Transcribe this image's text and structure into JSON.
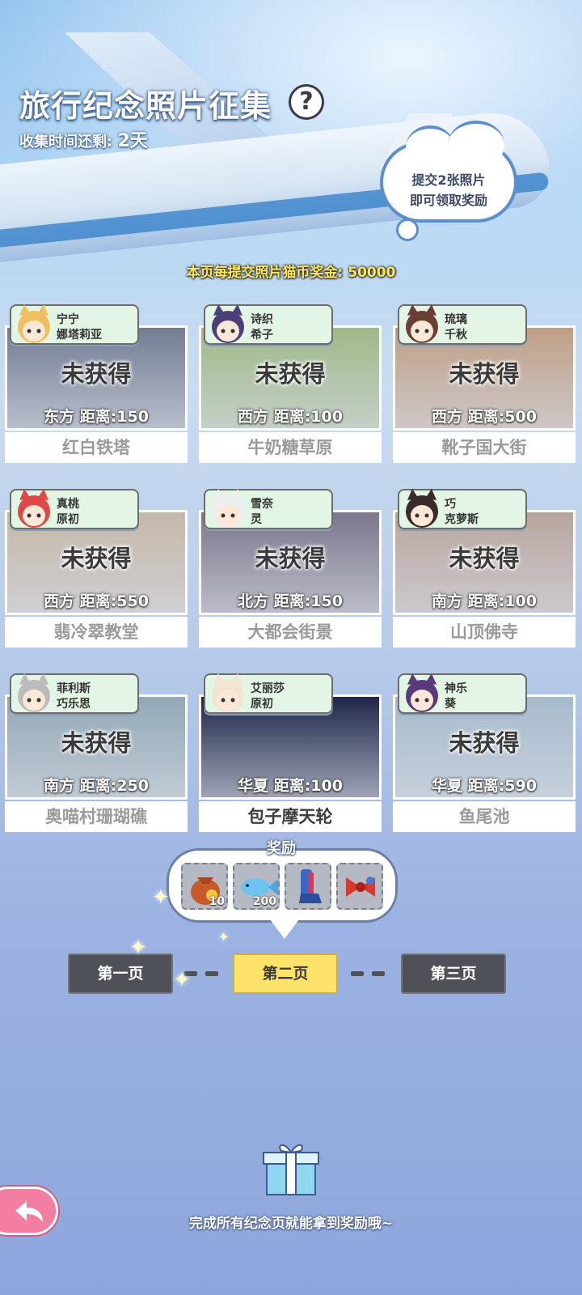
{
  "header": {
    "title": "旅行纪念照片征集",
    "help_symbol": "?",
    "timer_label": "收集时间还剩:",
    "timer_value": "2天",
    "cloud_line1": "提交2张照片",
    "cloud_line2": "即可领取奖励"
  },
  "bonus_text": "本页每提交照片猫币奖金: 50000",
  "cards": [
    {
      "name1": "宁宁",
      "name2": "娜塔莉亚",
      "status": "未获得",
      "direction": "东方",
      "distance": "距离:150",
      "location": "红白铁塔",
      "obtained": false,
      "scene": "#3b4a6a",
      "avatar_hair": "#f0c060"
    },
    {
      "name1": "诗织",
      "name2": "希子",
      "status": "未获得",
      "direction": "西方",
      "distance": "距离:100",
      "location": "牛奶糖草原",
      "obtained": false,
      "scene": "#7fa65a",
      "avatar_hair": "#4b3f78"
    },
    {
      "name1": "琉璃",
      "name2": "千秋",
      "status": "未获得",
      "direction": "西方",
      "distance": "距离:500",
      "location": "靴子国大街",
      "obtained": false,
      "scene": "#b07e55",
      "avatar_hair": "#6b3e36"
    },
    {
      "name1": "真桃",
      "name2": "原初",
      "status": "未获得",
      "direction": "西方",
      "distance": "距离:550",
      "location": "翡冷翠教堂",
      "obtained": false,
      "scene": "#b8a48c",
      "avatar_hair": "#e04848"
    },
    {
      "name1": "雪奈",
      "name2": "灵",
      "status": "未获得",
      "direction": "北方",
      "distance": "距离:150",
      "location": "大都会街景",
      "obtained": false,
      "scene": "#4a4060",
      "avatar_hair": "#eeeeee"
    },
    {
      "name1": "巧",
      "name2": "克萝斯",
      "status": "未获得",
      "direction": "南方",
      "distance": "距离:100",
      "location": "山顶佛寺",
      "obtained": false,
      "scene": "#a48878",
      "avatar_hair": "#3a2a2a"
    },
    {
      "name1": "菲利斯",
      "name2": "巧乐思",
      "status": "未获得",
      "direction": "南方",
      "distance": "距离:250",
      "location": "奥喵村珊瑚礁",
      "obtained": false,
      "scene": "#6a8ca0",
      "avatar_hair": "#bcbcbc"
    },
    {
      "name1": "艾丽莎",
      "name2": "原初",
      "status": "",
      "direction": "华夏",
      "distance": "距离:100",
      "location": "包子摩天轮",
      "obtained": true,
      "scene": "#20264a",
      "avatar_hair": "#f3e6d0"
    },
    {
      "name1": "神乐",
      "name2": "葵",
      "status": "未获得",
      "direction": "华夏",
      "distance": "距离:590",
      "location": "鱼尾池",
      "obtained": false,
      "scene": "#8aa8c0",
      "avatar_hair": "#5a3a7a"
    }
  ],
  "rewards": {
    "label": "奖励",
    "items": [
      {
        "icon": "coin-bag-icon",
        "qty": "10",
        "color": "#c85a2a"
      },
      {
        "icon": "blue-fish-icon",
        "qty": "200",
        "color": "#6ec4f0"
      },
      {
        "icon": "boots-icon",
        "qty": "",
        "color": "#3a66c8"
      },
      {
        "icon": "red-bow-icon",
        "qty": "",
        "color": "#d8382e"
      }
    ]
  },
  "pager": {
    "page1": "第一页",
    "page2": "第二页",
    "page3": "第三页",
    "active": 2
  },
  "footer_text": "完成所有纪念页就能拿到奖励哦~",
  "colors": {
    "active_page": "#fde36a",
    "inactive_page": "#4e5258",
    "name_tag": "#e3f6e6",
    "back_button": "#f27ea2"
  }
}
